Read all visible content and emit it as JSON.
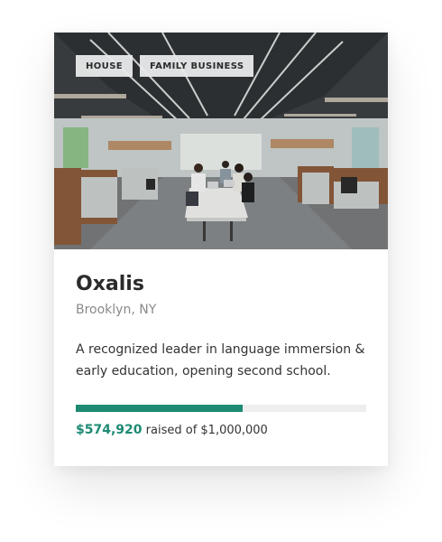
{
  "card": {
    "tags": [
      "HOUSE",
      "FAMILY BUSINESS"
    ],
    "image_icon": "office-photo",
    "title": "Oxalis",
    "location": "Brooklyn, NY",
    "description": "A recognized leader in language immersion & early education, opening second school.",
    "funding": {
      "raised_label": "$574,920",
      "raised_value": 574920,
      "goal_value": 1000000,
      "goal_text": "raised of $1,000,000",
      "progress_fraction": 0.5749
    }
  },
  "colors": {
    "accent": "#1d8a73",
    "title": "#2b2b2b",
    "muted": "#8a8a8a",
    "track": "#eeeeee"
  }
}
